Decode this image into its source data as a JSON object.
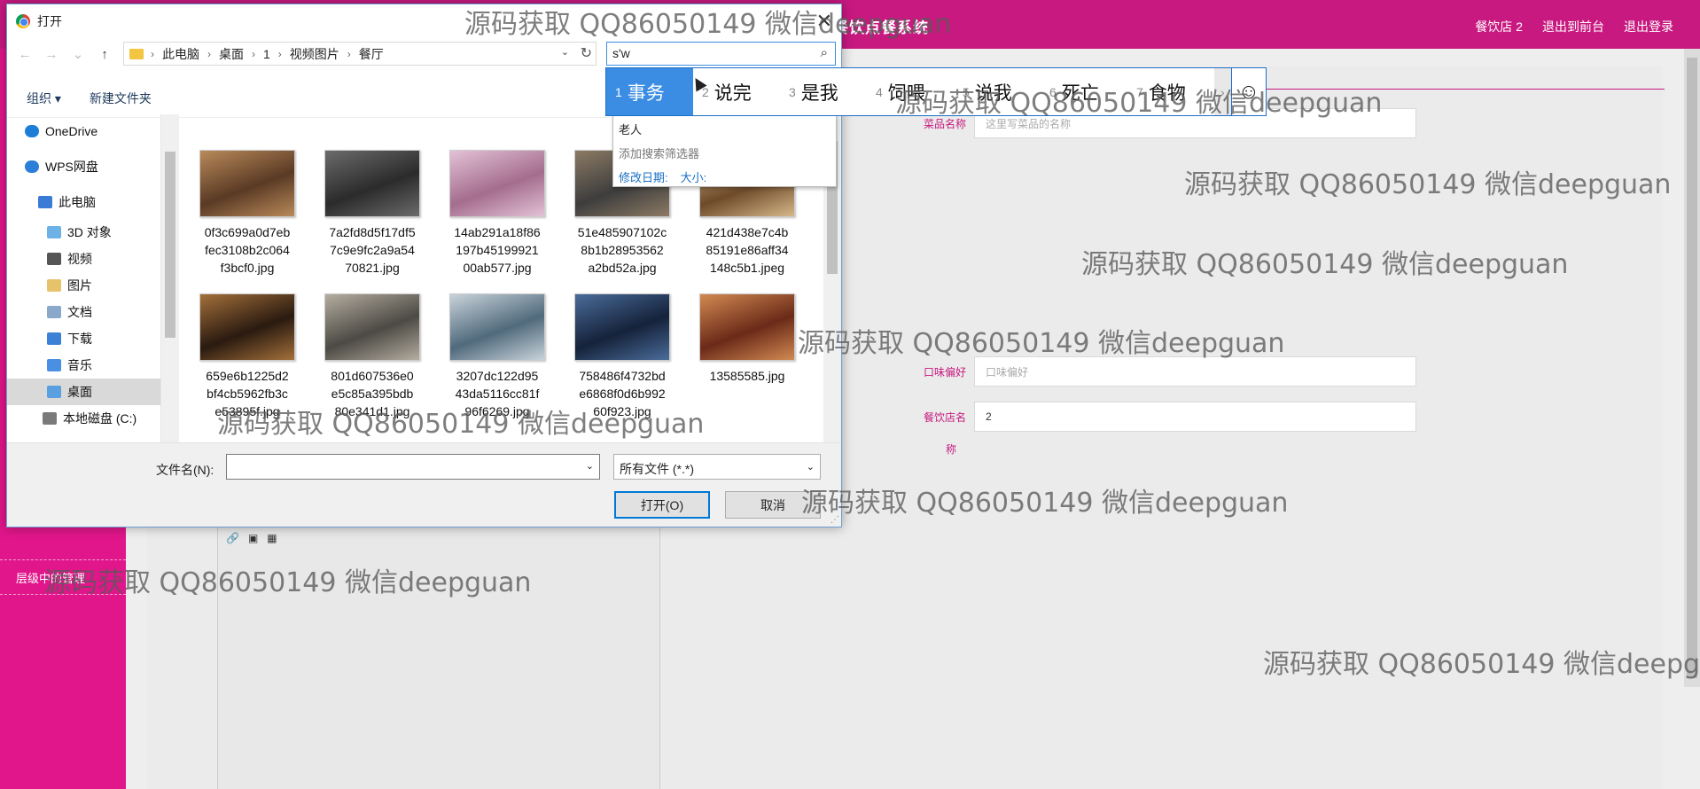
{
  "app": {
    "title": "餐饮点餐系统",
    "links": [
      "餐饮店 2",
      "退出到前台",
      "退出登录"
    ],
    "side_menu": "层级中的管理"
  },
  "form": {
    "fields": [
      {
        "label": "菜品名称",
        "value": "",
        "placeholder": "这里写菜品的名称"
      },
      {
        "label": "口味偏好",
        "value": "",
        "placeholder": "口味偏好"
      },
      {
        "label": "餐饮店名",
        "value": "2",
        "placeholder": ""
      }
    ],
    "wrap_label": "称"
  },
  "dialog": {
    "title": "打开",
    "close": "✕",
    "breadcrumbs": [
      "此电脑",
      "桌面",
      "1",
      "视频图片",
      "餐厅"
    ],
    "search_value": "s'w",
    "cmd": {
      "organize": "组织 ▾",
      "new_folder": "新建文件夹"
    },
    "tree": [
      {
        "label": "OneDrive",
        "icon": "cloud-icon",
        "color": "#1c7ed6"
      },
      {
        "label": "WPS网盘",
        "icon": "cloud-icon",
        "color": "#2b7fd8"
      },
      {
        "label": "此电脑",
        "icon": "pc-icon",
        "color": "#3a7bd5"
      },
      {
        "label": "3D 对象",
        "icon": "cube-icon",
        "color": "#6cb2e6"
      },
      {
        "label": "视频",
        "icon": "film-icon",
        "color": "#555"
      },
      {
        "label": "图片",
        "icon": "picture-icon",
        "color": "#e6c36b"
      },
      {
        "label": "文档",
        "icon": "document-icon",
        "color": "#8aa8c9"
      },
      {
        "label": "下载",
        "icon": "download-icon",
        "color": "#3b82d6"
      },
      {
        "label": "音乐",
        "icon": "music-icon",
        "color": "#4a90e2"
      },
      {
        "label": "桌面",
        "icon": "desktop-icon",
        "color": "#5aa0e0",
        "selected": true
      },
      {
        "label": "本地磁盘 (C:)",
        "icon": "disk-icon",
        "color": "#7a7a7a"
      }
    ],
    "files": [
      {
        "name": "0f3c699a0d7ebfec3108b2c064f3bcf0.jpg",
        "lines": [
          "0f3c699a0d7eb",
          "fec3108b2c064",
          "f3bcf0.jpg"
        ],
        "c1": "#5a3a24",
        "c2": "#b98a5a"
      },
      {
        "name": "7a2fd8d5f17df57c9e9fc2a9a5470821.jpg",
        "lines": [
          "7a2fd8d5f17df5",
          "7c9e9fc2a9a54",
          "70821.jpg"
        ],
        "c1": "#2b2b2b",
        "c2": "#6b6b6b"
      },
      {
        "name": "14ab291a18f86197b4519992100ab577.jpg",
        "lines": [
          "14ab291a18f86",
          "197b45199921",
          "00ab577.jpg"
        ],
        "c1": "#a46d8e",
        "c2": "#e3c2d6"
      },
      {
        "name": "51e485907102c8b1b28953562a2bd52a.jpg",
        "lines": [
          "51e485907102c",
          "8b1b28953562",
          "a2bd52a.jpg"
        ],
        "c1": "#3d3d3d",
        "c2": "#8c7a64"
      },
      {
        "name": "421d438e7c4b85191e86aff34148c5b1.jpeg",
        "lines": [
          "421d438e7c4b",
          "85191e86aff34",
          "148c5b1.jpeg"
        ],
        "c1": "#6e4a2a",
        "c2": "#d6b889"
      },
      {
        "name": "659e6b1225d2bf4cb5962fb3ce53895f.jpg",
        "lines": [
          "659e6b1225d2",
          "bf4cb5962fb3c",
          "e53895f.jpg"
        ],
        "c1": "#2a1a10",
        "c2": "#a3703a"
      },
      {
        "name": "801d607536e0e5c85a395bdb80e341d1.jpg",
        "lines": [
          "801d607536e0",
          "e5c85a395bdb",
          "80e341d1.jpg"
        ],
        "c1": "#4c4a44",
        "c2": "#b4ada0"
      },
      {
        "name": "3207dc122d9543da5116cc81f96f6269.jpg",
        "lines": [
          "3207dc122d95",
          "43da5116cc81f",
          "96f6269.jpg"
        ],
        "c1": "#506a7c",
        "c2": "#c9d3da"
      },
      {
        "name": "758486f4732bde6868f0d6b99260f923.jpg",
        "lines": [
          "758486f4732bd",
          "e6868f0d6b992",
          "60f923.jpg"
        ],
        "c1": "#15223a",
        "c2": "#4a6c9a"
      },
      {
        "name": "13585585.jpg",
        "lines": [
          "13585585.jpg"
        ],
        "c1": "#6b2a18",
        "c2": "#d18a52"
      }
    ],
    "suggestions": {
      "item": "老人",
      "filter_label": "添加搜索筛选器",
      "filters": [
        "修改日期:",
        "大小:"
      ]
    },
    "filename_label": "文件名(N):",
    "filename_value": "",
    "filetype": "所有文件 (*.*)",
    "open_button": "打开(O)",
    "cancel_button": "取消"
  },
  "ime": {
    "candidates": [
      {
        "n": "1",
        "text": "事务"
      },
      {
        "n": "2",
        "text": "说完"
      },
      {
        "n": "3",
        "text": "是我"
      },
      {
        "n": "4",
        "text": "饲喂"
      },
      {
        "n": "5",
        "text": "说我"
      },
      {
        "n": "6",
        "text": "死亡"
      },
      {
        "n": "7",
        "text": "食物"
      }
    ],
    "more": "›",
    "emoji": "☺"
  },
  "watermark": "源码获取 QQ86050149 微信deepguan",
  "colors": {
    "brand": "#c7197f",
    "sidebar": "#e0168a",
    "selected": "#3b8de4"
  }
}
